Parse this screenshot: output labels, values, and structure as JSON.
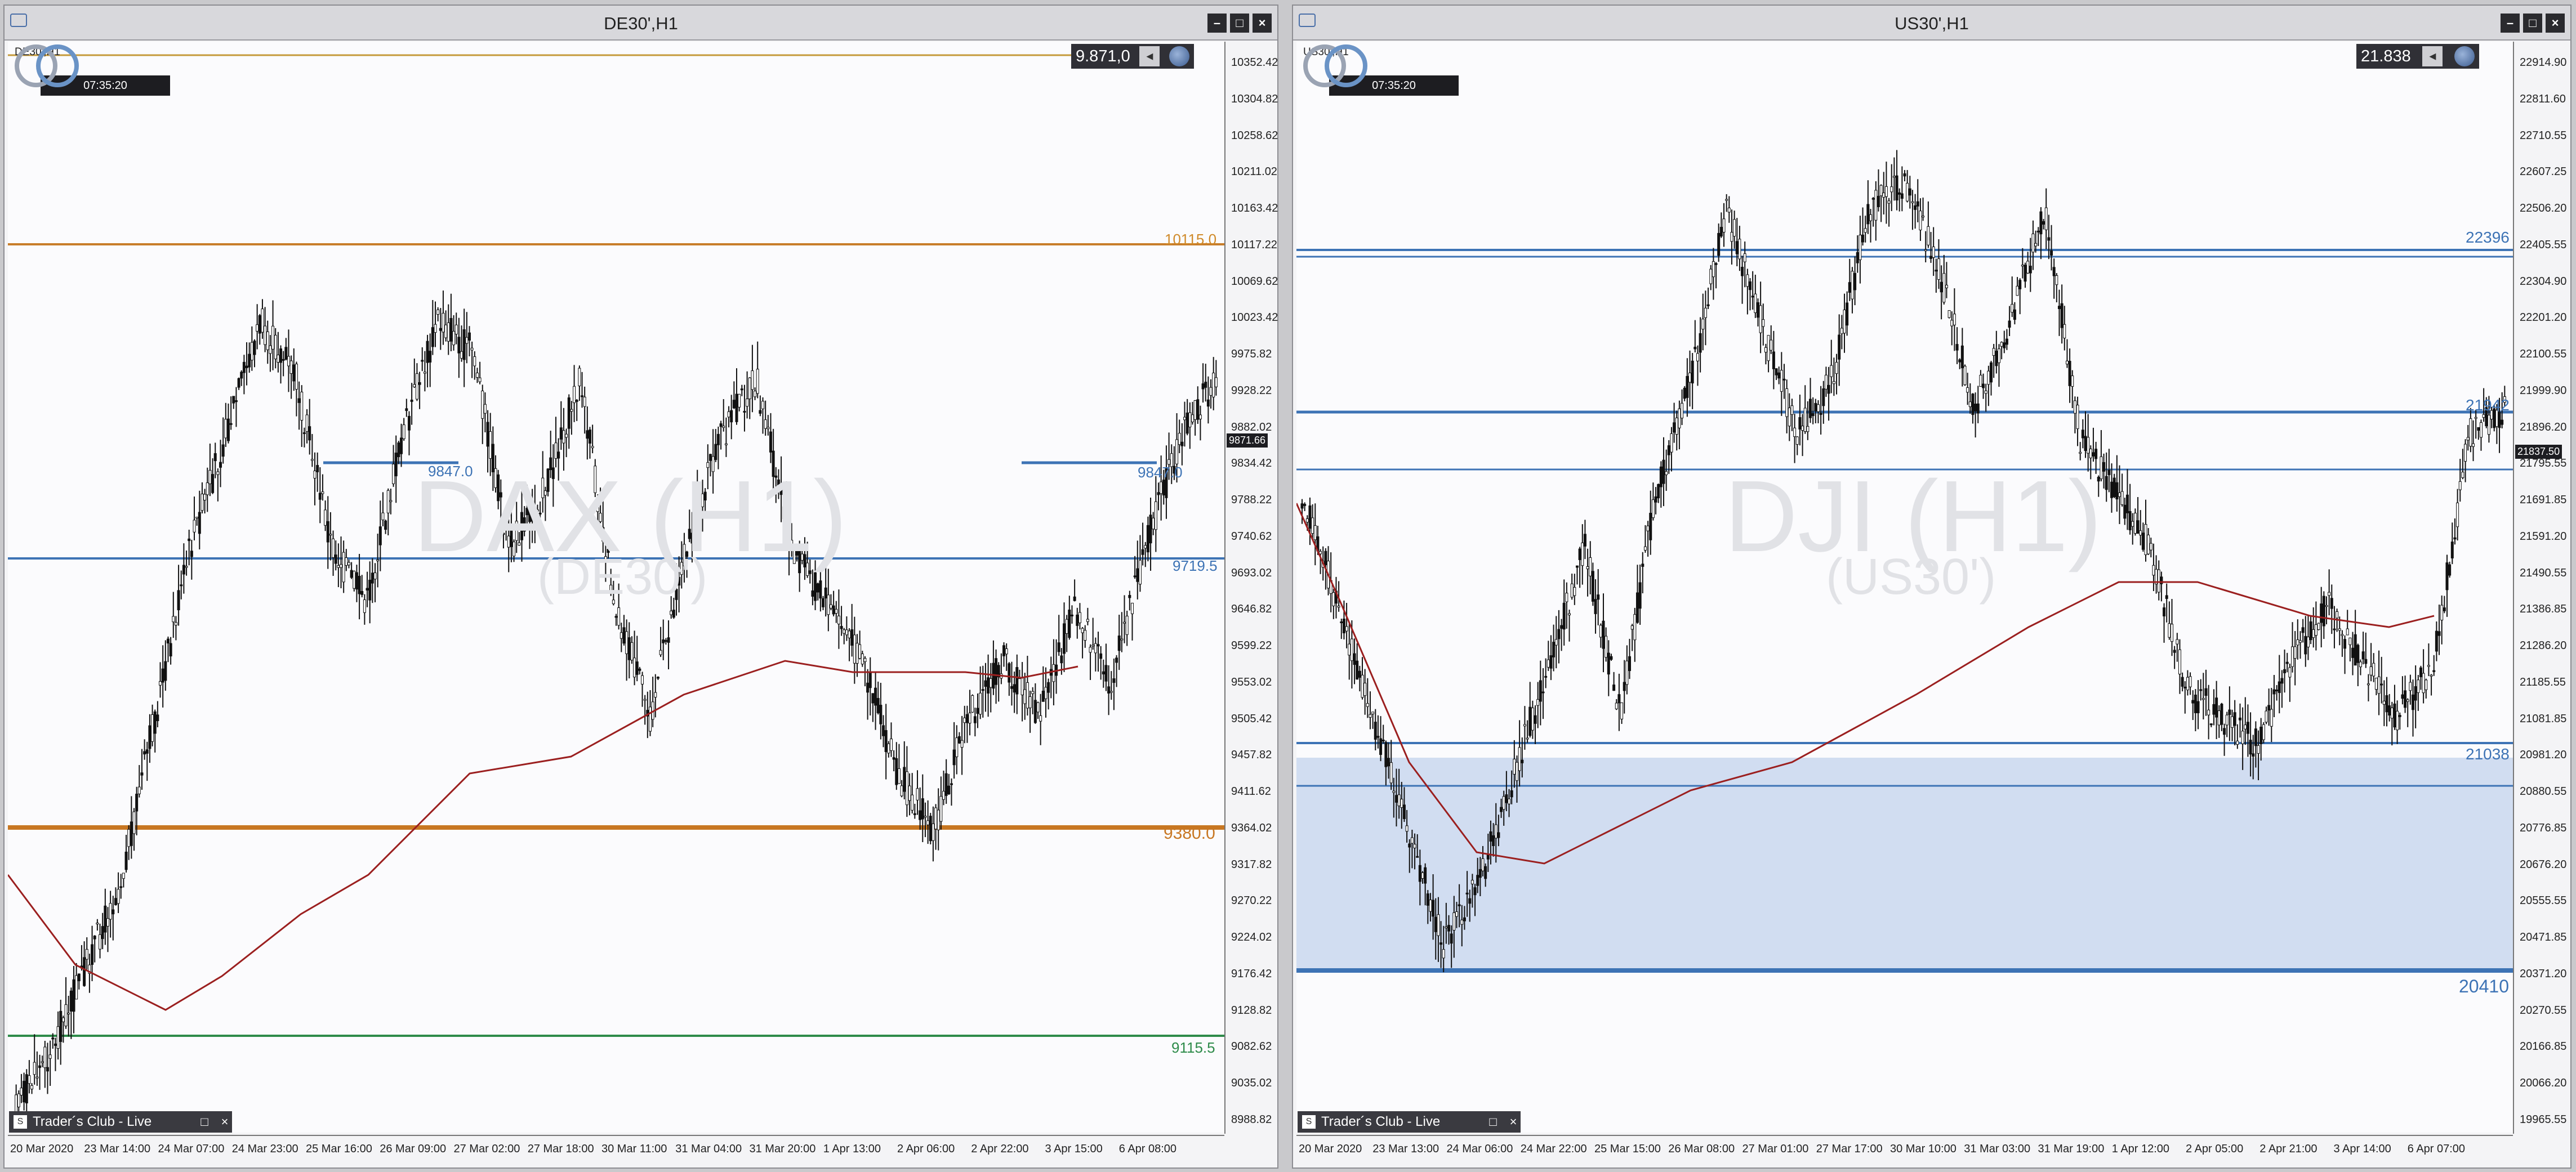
{
  "windows": [
    {
      "title": "DE30',H1",
      "symbol_label": "DE30',H1",
      "clock": "07:35:20",
      "price_box": "9.871,0",
      "watermark": "DAX (H1)",
      "watermark_sub": "(DE30')",
      "current_price_label": "9871.66",
      "y_ticks": [
        "10352.42",
        "10304.82",
        "10258.62",
        "10211.02",
        "10163.42",
        "10117.22",
        "10069.62",
        "10023.42",
        "9975.82",
        "9928.22",
        "9882.02",
        "9834.42",
        "9788.22",
        "9740.62",
        "9693.02",
        "9646.82",
        "9599.22",
        "9553.02",
        "9505.42",
        "9457.82",
        "9411.62",
        "9364.02",
        "9317.82",
        "9270.22",
        "9224.02",
        "9176.42",
        "9128.82",
        "9082.62",
        "9035.02",
        "8988.82"
      ],
      "x_ticks": [
        "20 Mar 2020",
        "23 Mar 14:00",
        "24 Mar 07:00",
        "24 Mar 23:00",
        "25 Mar 16:00",
        "26 Mar 09:00",
        "27 Mar 02:00",
        "27 Mar 18:00",
        "30 Mar 11:00",
        "31 Mar 04:00",
        "31 Mar 20:00",
        "1 Apr 13:00",
        "2 Apr 06:00",
        "2 Apr 22:00",
        "3 Apr 15:00",
        "6 Apr 08:00"
      ],
      "levels": [
        {
          "label": "10115.0",
          "value": 10115.0,
          "color": "#d08a2a"
        },
        {
          "label": "9847.0",
          "value": 9847.0,
          "color": "#3d73b5"
        },
        {
          "label": "9847.0",
          "value": 9847.0,
          "color": "#3d73b5"
        },
        {
          "label": "9719.5",
          "value": 9719.5,
          "color": "#3d73b5"
        },
        {
          "label": "9380.0",
          "value": 9380.0,
          "color": "#c87722"
        },
        {
          "label": "9115.5",
          "value": 9115.5,
          "color": "#2e8b4a"
        }
      ],
      "live_label": "Trader´s Club - Live"
    },
    {
      "title": "US30',H1",
      "symbol_label": "US30',H1",
      "clock": "07:35:20",
      "price_box": "21.838",
      "watermark": "DJI (H1)",
      "watermark_sub": "(US30')",
      "current_price_label": "21837.50",
      "y_ticks": [
        "22914.90",
        "22811.60",
        "22710.55",
        "22607.25",
        "22506.20",
        "22405.55",
        "22304.90",
        "22201.20",
        "22100.55",
        "21999.90",
        "21896.20",
        "21795.55",
        "21691.85",
        "21591.20",
        "21490.55",
        "21386.85",
        "21286.20",
        "21185.55",
        "21081.85",
        "20981.20",
        "20880.55",
        "20776.85",
        "20676.20",
        "20555.55",
        "20471.85",
        "20371.20",
        "20270.55",
        "20166.85",
        "20066.20",
        "19965.55"
      ],
      "x_ticks": [
        "20 Mar 2020",
        "23 Mar 13:00",
        "24 Mar 06:00",
        "24 Mar 22:00",
        "25 Mar 15:00",
        "26 Mar 08:00",
        "27 Mar 01:00",
        "27 Mar 17:00",
        "30 Mar 10:00",
        "31 Mar 03:00",
        "31 Mar 19:00",
        "1 Apr 12:00",
        "2 Apr 05:00",
        "2 Apr 21:00",
        "3 Apr 14:00",
        "6 Apr 07:00"
      ],
      "levels": [
        {
          "label": "22396",
          "value": 22396,
          "color": "#3d73b5"
        },
        {
          "label": "21942",
          "value": 21942,
          "color": "#3d73b5"
        },
        {
          "label": "21038",
          "value": 21038,
          "color": "#3d73b5"
        },
        {
          "label": "20410",
          "value": 20410,
          "color": "#3d73b5"
        }
      ],
      "live_label": "Trader´s Club - Live"
    }
  ]
}
